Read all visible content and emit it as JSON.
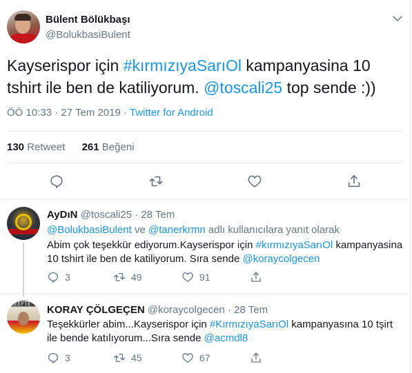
{
  "tweet": {
    "author_name": "Bülent Bölükbaşı",
    "author_handle": "@BolukbasiBulent",
    "text_1": "Kayserispor için ",
    "hashtag": "#kırmızıyaSarıOl",
    "text_2": " kampanyasina 10 tshirt ile ben de katiliyorum. ",
    "mention": "@toscali25",
    "text_3": " top sende :))",
    "time": "ÖÖ 10:33 · 27 Tem 2019 · ",
    "source": "Twitter for Android",
    "retweet_count": "130",
    "retweet_label": "Retweet",
    "like_count": "261",
    "like_label": "Beğeni"
  },
  "replies": [
    {
      "name": "AyDıN",
      "handle": "@toscali25",
      "date": "· 28 Tem",
      "reply_to_1": "@BolukbasiBulent",
      "reply_to_and": " ve ",
      "reply_to_2": "@tanerkrmn",
      "reply_to_suffix": " adlı kullanıcılara yanıt olarak",
      "text_1": "Abim çok teşekkür ediyorum.Kayserispor için ",
      "hashtag": "#kırmızıyaSarıOl",
      "text_2": " kampanyasina 10 tshirt ile ben de katiliyorum. Sıra sende ",
      "mention": "@koraycolgecen",
      "reply_count": "3",
      "retweet_count": "49",
      "like_count": "91"
    },
    {
      "name": "KORAY ÇÖLGEÇEN",
      "handle": "@koraycolgecen",
      "date": "· 28 Tem",
      "text_1": "Teşekkürler abim...Kayserispor için ",
      "hashtag": "#KırmızıyaSarıOl",
      "text_2": " kampanyasına 10 tşirt ile bende katılıyorum...Sıra sende ",
      "mention": "@acmdl8",
      "reply_count": "3",
      "retweet_count": "45",
      "like_count": "67",
      "avatar_text": "LEEFTE"
    }
  ],
  "icons": [
    "reply-icon",
    "retweet-icon",
    "like-icon",
    "share-icon",
    "chevron-down-icon"
  ],
  "colors": {
    "link": "#1b95e0",
    "muted": "#657786",
    "text": "#14171a",
    "divider": "#e6ecf0"
  }
}
